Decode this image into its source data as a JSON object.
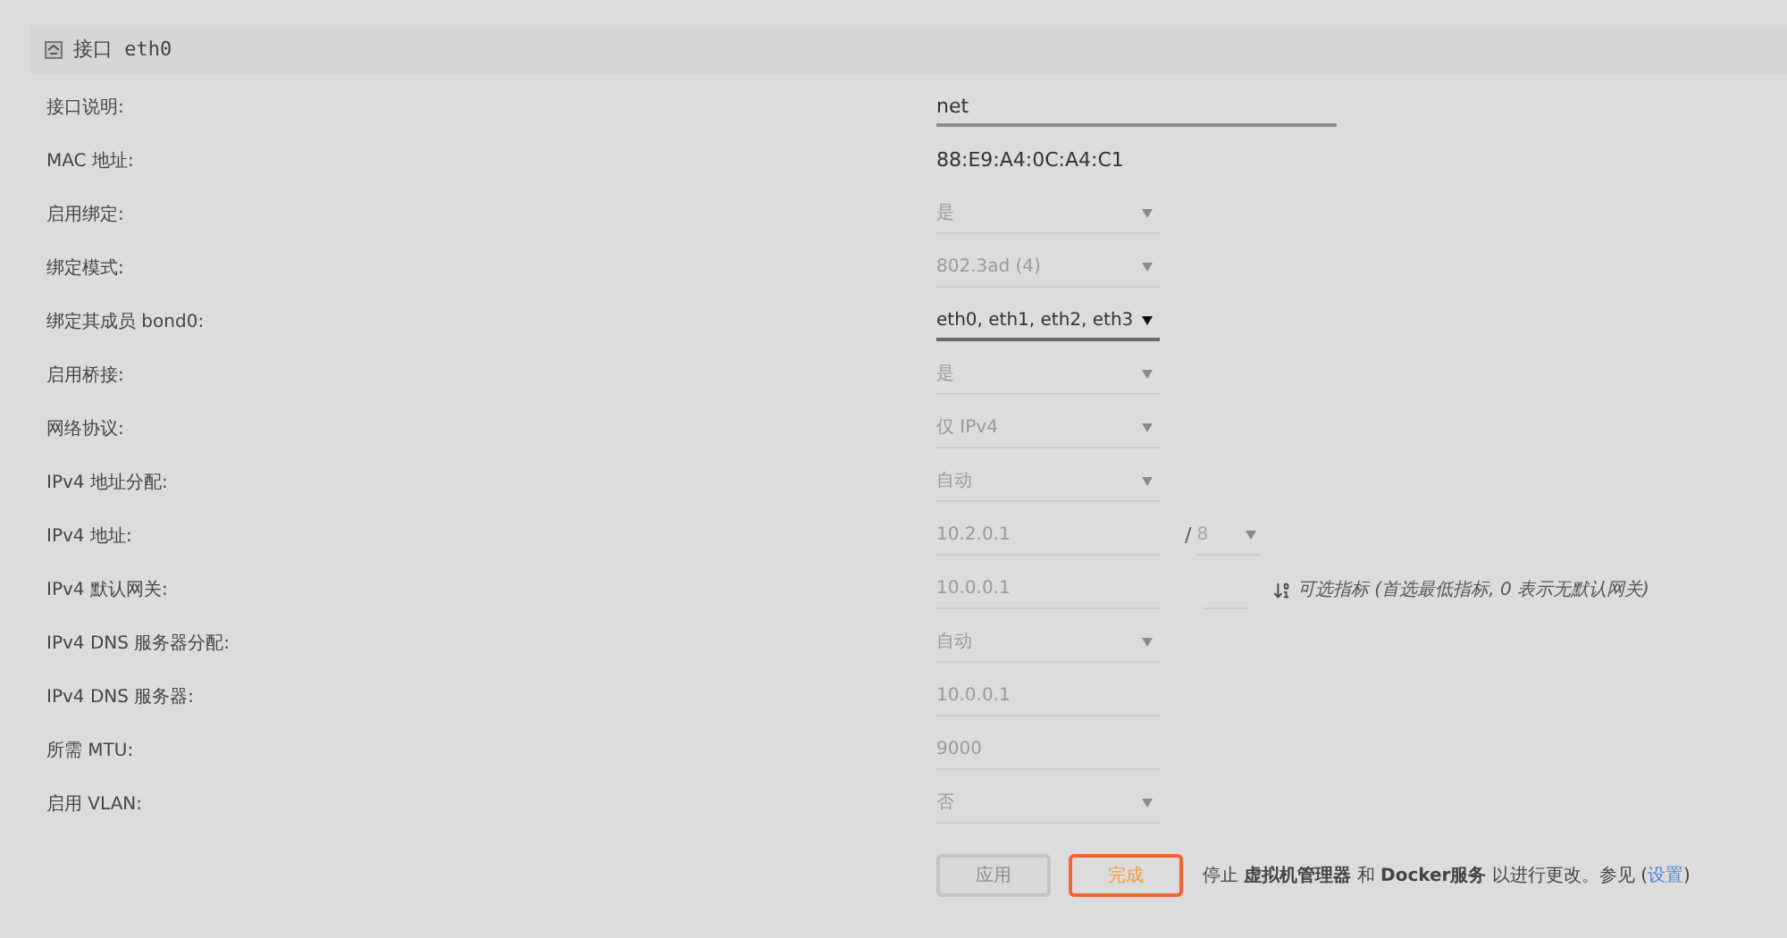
{
  "header": {
    "title": "接口 eth0"
  },
  "rows": [
    {
      "label": "接口说明:",
      "kind": "input",
      "value": "net",
      "disabled": false
    },
    {
      "label": "MAC 地址:",
      "kind": "text",
      "value": "88:E9:A4:0C:A4:C1"
    },
    {
      "label": "启用绑定:",
      "kind": "select",
      "value": "是",
      "disabled": true
    },
    {
      "label": "绑定模式:",
      "kind": "select",
      "value": "802.3ad (4)",
      "disabled": true
    },
    {
      "label": "绑定其成员 bond0:",
      "kind": "select",
      "value": "eth0, eth1, eth2, eth3",
      "disabled": false
    },
    {
      "label": "启用桥接:",
      "kind": "select",
      "value": "是",
      "disabled": true
    },
    {
      "label": "网络协议:",
      "kind": "select",
      "value": "仅 IPv4",
      "disabled": true
    },
    {
      "label": "IPv4 地址分配:",
      "kind": "select",
      "value": "自动",
      "disabled": true
    },
    {
      "label": "IPv4 地址:",
      "kind": "field",
      "value": "10.2.0.1",
      "disabled": true,
      "prefix": {
        "separator": "/",
        "value": "8"
      }
    },
    {
      "label": "IPv4 默认网关:",
      "kind": "field",
      "value": "10.0.0.1",
      "disabled": true,
      "metric": {
        "hint": "可选指标 (首选最低指标, 0 表示无默认网关)"
      }
    },
    {
      "label": "IPv4 DNS 服务器分配:",
      "kind": "select",
      "value": "自动",
      "disabled": true
    },
    {
      "label": "IPv4 DNS 服务器:",
      "kind": "field",
      "value": "10.0.0.1",
      "disabled": true
    },
    {
      "label": "所需 MTU:",
      "kind": "field",
      "value": "9000",
      "disabled": true
    },
    {
      "label": "启用 VLAN:",
      "kind": "select",
      "value": "否",
      "disabled": true
    }
  ],
  "footer": {
    "buttons": [
      {
        "label": "应用",
        "kind": "plain",
        "disabled": true
      },
      {
        "label": "完成",
        "kind": "accent",
        "disabled": false
      }
    ],
    "message": "停止 **虚拟机管理器** 和 **Docker服务** 以进行更改。参见 (",
    "link": "设置",
    "message_end": ")"
  }
}
